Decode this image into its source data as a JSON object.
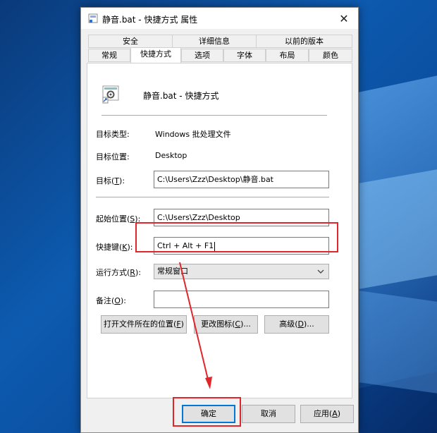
{
  "window": {
    "title": "静音.bat - 快捷方式 属性",
    "close_label": "✕"
  },
  "tabs_row1": [
    {
      "label": "安全"
    },
    {
      "label": "详细信息"
    },
    {
      "label": "以前的版本"
    }
  ],
  "tabs_row2": [
    {
      "label": "常规"
    },
    {
      "label": "快捷方式",
      "active": true
    },
    {
      "label": "选项"
    },
    {
      "label": "字体"
    },
    {
      "label": "布局"
    },
    {
      "label": "颜色"
    }
  ],
  "header": {
    "name": "静音.bat - 快捷方式",
    "icon": "shortcut-gear-icon"
  },
  "fields": {
    "target_type_label": "目标类型:",
    "target_type_value": "Windows 批处理文件",
    "target_location_label": "目标位置:",
    "target_location_value": "Desktop",
    "target_label": "目标(",
    "target_key": "T",
    "target_value": "C:\\Users\\Zzz\\Desktop\\静音.bat",
    "start_in_label": "起始位置(",
    "start_in_key": "S",
    "start_in_value": "C:\\Users\\Zzz\\Desktop",
    "hotkey_label": "快捷键(",
    "hotkey_key": "K",
    "hotkey_value": "Ctrl + Alt + F1",
    "run_label": "运行方式(",
    "run_key": "R",
    "run_value": "常规窗口",
    "comment_label": "备注(",
    "comment_key": "O",
    "comment_value": "",
    "label_end": "):"
  },
  "buttons": {
    "open_location": "打开文件所在的位置(",
    "open_location_key": "F",
    "change_icon": "更改图标(",
    "change_icon_key": "C",
    "advanced": "高级(",
    "advanced_key": "D",
    "dots_end": ")...",
    "close_paren": ")",
    "ok": "确定",
    "cancel": "取消",
    "apply": "应用(",
    "apply_key": "A"
  },
  "colors": {
    "annotation": "#e0262b",
    "accent": "#0078d7"
  }
}
